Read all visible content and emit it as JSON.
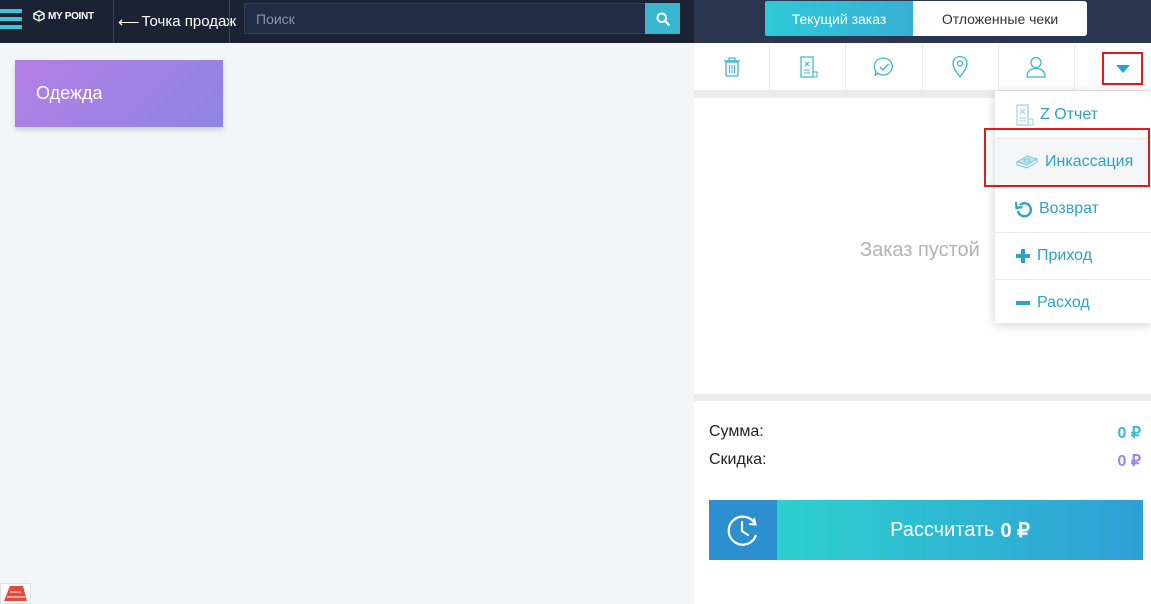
{
  "app": {
    "logo_text": "MY POINT",
    "accent_color": "#3ab8d4",
    "topbar_color": "#1a2233"
  },
  "header": {
    "back_label": "Точка продаж",
    "search": {
      "placeholder": "Поиск",
      "value": ""
    },
    "tabs": [
      {
        "label": "Текущий заказ",
        "active": true
      },
      {
        "label": "Отложенные чеки",
        "active": false
      }
    ]
  },
  "categories": [
    {
      "label": "Одежда"
    }
  ],
  "order": {
    "empty_text": "Заказ пустой",
    "toolbar_icons": [
      "trash-icon",
      "receipt-icon",
      "comment-check-icon",
      "location-icon",
      "user-icon",
      "caret-down-icon"
    ],
    "sum_label": "Сумма:",
    "sum_value": "0 ₽",
    "discount_label": "Скидка:",
    "discount_value": "0 ₽",
    "pay_label": "Рассчитать",
    "pay_amount": "0 ₽"
  },
  "menu": {
    "items": [
      {
        "label": "Z Отчет",
        "icon": "z-report-icon"
      },
      {
        "label": "Инкассация",
        "icon": "money-stack-icon",
        "highlighted": true
      },
      {
        "label": "Возврат",
        "icon": "undo-icon"
      },
      {
        "label": "Приход",
        "icon": "plus-icon"
      },
      {
        "label": "Расход",
        "icon": "minus-icon"
      }
    ]
  }
}
